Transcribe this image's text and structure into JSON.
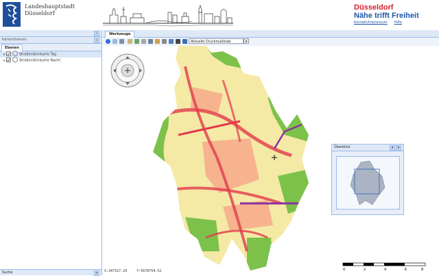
{
  "header": {
    "city_line1": "Landeshauptstadt",
    "city_line2": "Düsseldorf",
    "brand_city": "Düsseldorf",
    "brand_slogan": "Nähe trifft Freiheit",
    "link_contact": "Kontakt/Impressum",
    "link_help": "Hilfe"
  },
  "leftpanel": {
    "title": "Kartenthemen",
    "tab_layers": "Ebenen",
    "layers": [
      {
        "label": "Straßenlärmkarte Tag",
        "checked": true
      },
      {
        "label": "Straßenlärmkarte Nacht",
        "checked": true
      }
    ],
    "footer": "Suche"
  },
  "main": {
    "tab_tools": "Werkzeuge",
    "scale_select": "Aktuelle Druckmaßstab",
    "overview_title": "Überblick",
    "coord_x": "X:347327.29",
    "coord_y": "Y:5678754.52",
    "scale_ticks": [
      "0",
      "2",
      "4",
      "6",
      "8"
    ]
  },
  "colors": {
    "accent_border": "#99bbe8",
    "panel_bg": "#dfe8f6",
    "brand_red": "#d31f2b",
    "brand_blue": "#1f55a8",
    "noise_low": "#f5e9a6",
    "noise_mid": "#f6b38e",
    "noise_high": "#e2394b",
    "noise_very_high": "#8b2fa0",
    "green_areas": "#7cc24a"
  },
  "icons": [
    "city-logo-icon",
    "skyline-illustration",
    "collapse-icon",
    "close-icon",
    "pan-zoom-navigator-icon",
    "info-icon",
    "zoom-in-icon",
    "zoom-out-icon",
    "measure-icon",
    "print-icon",
    "home-icon",
    "legend-icon"
  ]
}
